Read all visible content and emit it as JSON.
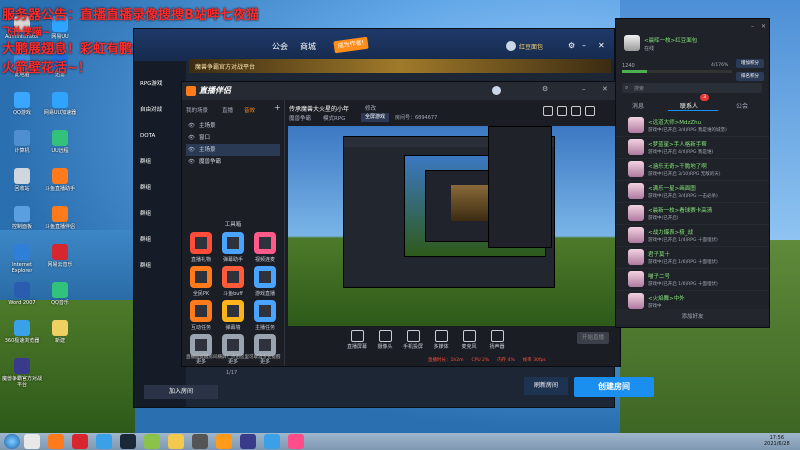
{
  "overlay": {
    "lines": [
      "服务器公告：直播直播录像搜搜B站哔七夜猫",
      "飞扑侠喵~",
      "大鹏展翅息！彩虹有鹏大不同~打出",
      "火箭壁花活~！"
    ]
  },
  "desktop_icons": [
    {
      "label": "Administrator",
      "color": "#d9d9d9"
    },
    {
      "label": "网易UU",
      "color": "#2fa4ff"
    },
    {
      "label": "此电脑",
      "color": "#3d8ee0"
    },
    {
      "label": "迅雷",
      "color": "#1e6fd9"
    },
    {
      "label": "QQ游戏",
      "color": "#3aa6ff"
    },
    {
      "label": "网易UU加速器",
      "color": "#2fa4ff"
    },
    {
      "label": "计算机",
      "color": "#4f8fd0"
    },
    {
      "label": "UU远程",
      "color": "#34c27a"
    },
    {
      "label": "回收站",
      "color": "#d0d6de"
    },
    {
      "label": "斗鱼直播助手",
      "color": "#ff7a1a"
    },
    {
      "label": "控制面板",
      "color": "#5a9fe0"
    },
    {
      "label": "斗鱼直播伴侣",
      "color": "#ff7a1a"
    },
    {
      "label": "Internet Explorer",
      "color": "#2f7fd9"
    },
    {
      "label": "网易云音乐",
      "color": "#d8262f"
    },
    {
      "label": "Word 2007",
      "color": "#2a5db0"
    },
    {
      "label": "QQ音乐",
      "color": "#31c27c"
    },
    {
      "label": "360极速浏览器",
      "color": "#3aa0e8"
    },
    {
      "label": "新建",
      "color": "#f0d060"
    },
    {
      "label": "魔兽争霸官方对战平台",
      "color": "#3a3a8a"
    }
  ],
  "back_app": {
    "nav": [
      "公会",
      "商城"
    ],
    "user": "红豆面包",
    "banner": "魔兽争霸官方对战平台",
    "sidebar": [
      "RPG游戏",
      "自由对战",
      "DOTA",
      "群组",
      "群组",
      "群组",
      "群组",
      "群组"
    ],
    "join_room": "加入房间",
    "refresh_room": "刷新房间",
    "create_room": "创建房间",
    "tag": "成为作者!"
  },
  "front_app": {
    "title": "直播伴侣",
    "tabs": [
      "我的场景",
      "直播",
      "音效"
    ],
    "scenes": [
      {
        "label": "主场景",
        "active": false
      },
      {
        "label": "窗口",
        "active": false
      },
      {
        "label": "主场景",
        "active": true
      },
      {
        "label": "魔兽争霸",
        "active": false
      }
    ],
    "toolbox_title": "工具箱",
    "tools": [
      {
        "label": "直播礼物",
        "color": "#ff4d3a"
      },
      {
        "label": "弹幕助手",
        "color": "#4aa3ff"
      },
      {
        "label": "视频连麦",
        "color": "#ff5a8a"
      },
      {
        "label": "全民PK",
        "color": "#ff7a1a"
      },
      {
        "label": "斗鱼buff",
        "color": "#ff5a3a"
      },
      {
        "label": "游戏直播",
        "color": "#4aa3ff"
      },
      {
        "label": "互动任务",
        "color": "#ff7a1a"
      },
      {
        "label": "弹幕墙",
        "color": "#ffb31a"
      },
      {
        "label": "主播任务",
        "color": "#4aa3ff"
      },
      {
        "label": "更多",
        "color": "#9aa3b0"
      },
      {
        "label": "更多",
        "color": "#9aa3b0"
      },
      {
        "label": "更多",
        "color": "#9aa3b0"
      }
    ],
    "page_indicator": "1/17",
    "notice": "直播间提醒房间横屏！点击这里可取消专业提醒",
    "stream_title": "传承魔兽大火星的小年",
    "stream_tag": "修改",
    "category": "魔兽争霸",
    "category2": "模式RPG",
    "fullscreen_btn": "全屏游戏",
    "room_no": "房间号：6894677",
    "bottom_tools": [
      "直播屏幕",
      "摄像头",
      "手机投屏",
      "多媒体",
      "麦克风",
      "扬声器"
    ],
    "stats": [
      "直播时长：1h2m",
      "CPU 2%",
      "内存 4%",
      "帧率 30fps"
    ],
    "start_live": "开始直播"
  },
  "chat": {
    "profile_name": "<晨晖一枚>红豆面包",
    "profile_status": "在线",
    "level": "1240",
    "progress_text": "4/176%",
    "progress_fraction": 0.23,
    "btn1": "增加积分",
    "btn2": "排名积分",
    "search_placeholder": "搜索",
    "tabs": [
      "消息",
      "联系人",
      "公会"
    ],
    "contact_badge": "3",
    "friends": [
      {
        "name": "<远道大师>MdzZhu",
        "status": "游戏中(已开启 3/4)RPG 我是谁的城堡)"
      },
      {
        "name": "<梦蓝星>手人格新手帮",
        "status": "游戏中(已开启 4/4)RPG 我是谁)"
      },
      {
        "name": "<涵乐无奇>干脆地了啊",
        "status": "游戏中(已开启 3/10)RPG 无敌的天)"
      },
      {
        "name": "<满乐一星>画面图",
        "status": "游戏中(已开启 3/4)RPG 一击必杀)"
      },
      {
        "name": "<晨新一枚>看球赛卡高清",
        "status": "游戏中(已开启)"
      },
      {
        "name": "<战力爆表>极_战",
        "status": "游戏中(已开启 1/4)RPG 十面埋伏)"
      },
      {
        "name": "君子莫十",
        "status": "游戏中(已开启 1/6)RPG 十面埋伏)"
      },
      {
        "name": "喵子二号",
        "status": "游戏中(已开启 1/6)RPG 十面埋伏)"
      },
      {
        "name": "<火焰舞>中外",
        "status": "游戏中"
      }
    ],
    "add_friend": "添加好友"
  },
  "taskbar": {
    "time": "17:56",
    "date": "2021/6/28",
    "apps": [
      "#e8e8e8",
      "#ff7a1a",
      "#d8262f",
      "#3aa0e8",
      "#1b2838",
      "#8bc34a",
      "#f2c94c",
      "#555",
      "#ff9a1a",
      "#3a3a8a",
      "#3aa0e8",
      "#ff4d8a"
    ]
  }
}
